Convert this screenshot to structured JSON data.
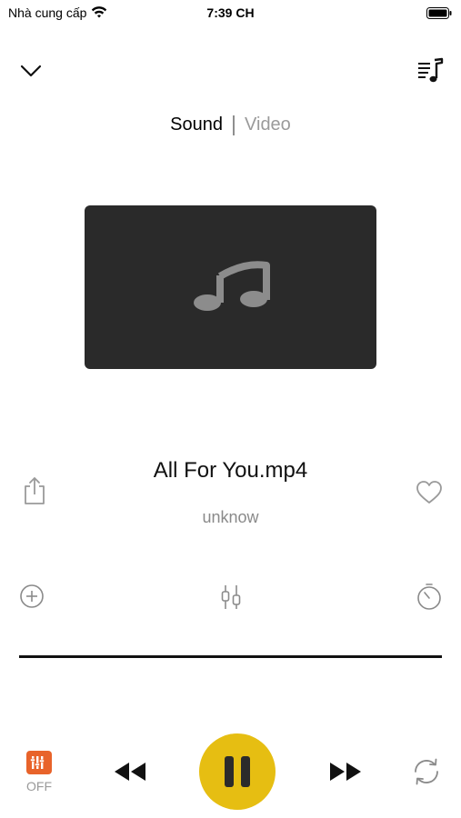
{
  "status_bar": {
    "carrier": "Nhà cung cấp",
    "time": "7:39 CH",
    "wifi_icon": "wifi-icon",
    "battery_icon": "battery-icon"
  },
  "header": {
    "collapse_icon": "chevron-down-icon",
    "playlist_icon": "playlist-icon"
  },
  "segment": {
    "tabs": [
      {
        "label": "Sound",
        "selected": true
      },
      {
        "label": "Video",
        "selected": false
      }
    ]
  },
  "artwork": {
    "icon": "music-note-icon"
  },
  "track": {
    "title": "All For You.mp4",
    "artist": "unknow"
  },
  "actions": {
    "share_icon": "share-icon",
    "favorite_icon": "heart-icon",
    "add_icon": "add-circle-icon",
    "equalizer_icon": "equalizer-icon",
    "timer_icon": "timer-icon"
  },
  "controls": {
    "volume_boost_label": "OFF",
    "rewind_icon": "rewind-icon",
    "pause_icon": "pause-icon",
    "fast_forward_icon": "fast-forward-icon",
    "repeat_icon": "repeat-icon",
    "play_button_color": "#e6be12",
    "volume_boost_color": "#e8632a"
  }
}
